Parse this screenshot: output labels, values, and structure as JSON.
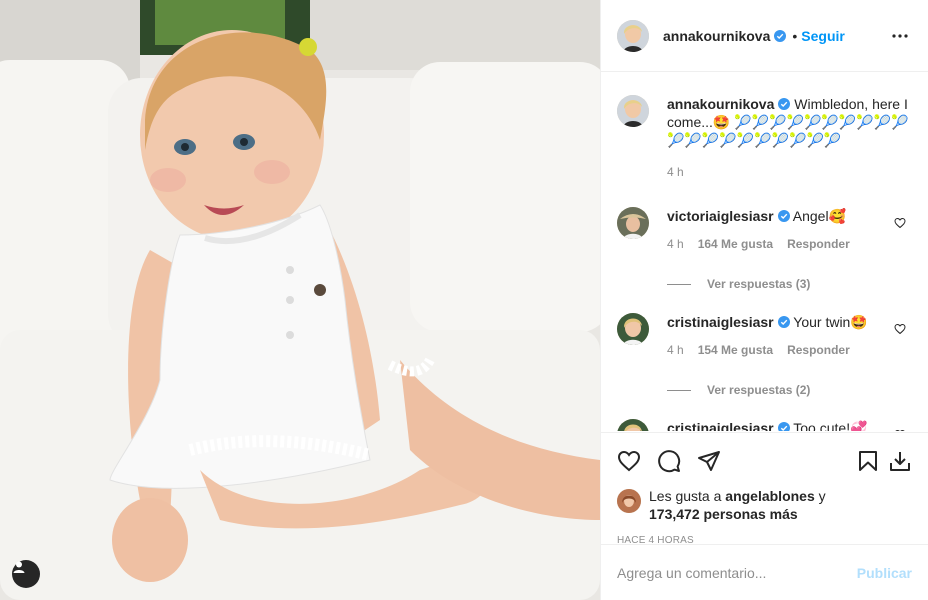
{
  "post": {
    "author": "annakournikova",
    "follow_label": "Seguir",
    "dot": "•",
    "caption_user": "annakournikova",
    "caption_text": "Wimbledon, here I come...🤩 🎾🎾🎾🎾🎾🎾🎾🎾🎾🎾🎾🎾🎾🎾🎾🎾🎾🎾🎾🎾",
    "caption_time": "4 h"
  },
  "comments": [
    {
      "user": "victoriaiglesiasr",
      "text": "Angel🥰",
      "time": "4 h",
      "likes": "164 Me gusta",
      "reply": "Responder",
      "view_replies": "Ver respuestas (3)"
    },
    {
      "user": "cristinaiglesiasr",
      "text": "Your twin🤩",
      "time": "4 h",
      "likes": "154 Me gusta",
      "reply": "Responder",
      "view_replies": "Ver respuestas (2)"
    },
    {
      "user": "cristinaiglesiasr",
      "text": "Too cute!💞"
    }
  ],
  "likes": {
    "prefix": "Les gusta a",
    "user": "angelablones",
    "and": "y",
    "count": "173,472 personas más"
  },
  "posted_ago": "HACE 4 HORAS",
  "add_comment": {
    "placeholder": "Agrega un comentario...",
    "post_label": "Publicar"
  },
  "icons": {
    "verified": "verified-badge-icon",
    "more": "more-options-icon",
    "like": "heart-icon",
    "comment": "comment-icon",
    "share": "share-icon",
    "save": "bookmark-icon",
    "download": "download-icon",
    "tag": "user-tag-icon"
  },
  "colors": {
    "link": "#0095f6",
    "verified": "#3897f0",
    "muted": "#8e8e8e",
    "post_disabled": "#b2dffc"
  }
}
